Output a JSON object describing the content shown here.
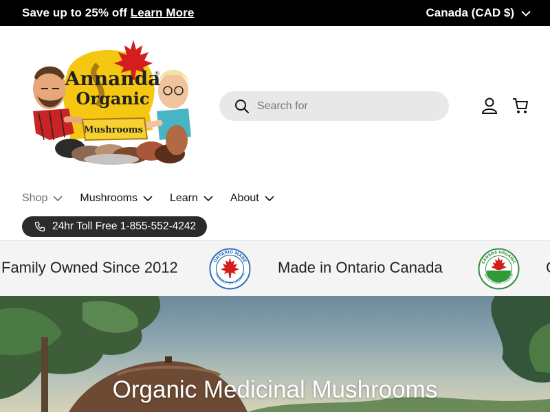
{
  "announcement": {
    "promo_text": "Save up to 25% off",
    "promo_link": "Learn More",
    "currency": "Canada (CAD $)"
  },
  "logo": {
    "line1": "Annanda",
    "line2": "Organic",
    "line3": "Mushrooms",
    "registered": "®"
  },
  "search": {
    "placeholder": "Search for"
  },
  "header_icons": [
    "account-icon",
    "cart-icon"
  ],
  "nav": {
    "items": [
      {
        "label": "Shop"
      },
      {
        "label": "Mushrooms"
      },
      {
        "label": "Learn"
      },
      {
        "label": "About"
      }
    ]
  },
  "phone": {
    "label": "24hr Toll Free 1-855-552-4242"
  },
  "strip": {
    "texts": [
      "Family Owned Since 2012",
      "Made in Ontario Canada",
      "C"
    ],
    "ontario_badge": {
      "top": "ONTARIO MADE",
      "bottom": "FABRIQUE EN ONTARIO"
    },
    "organic_badge": {
      "top": "CANADA ORGANIC",
      "bottom": "BIOLOGIQUE CANADA"
    }
  },
  "hero": {
    "title": "Organic Medicinal Mushrooms"
  },
  "colors": {
    "announce_bg": "#000000",
    "search_bg": "#e8e8e8",
    "pill_bg": "#2b2b2b",
    "strip_bg": "#f4f4f4"
  }
}
